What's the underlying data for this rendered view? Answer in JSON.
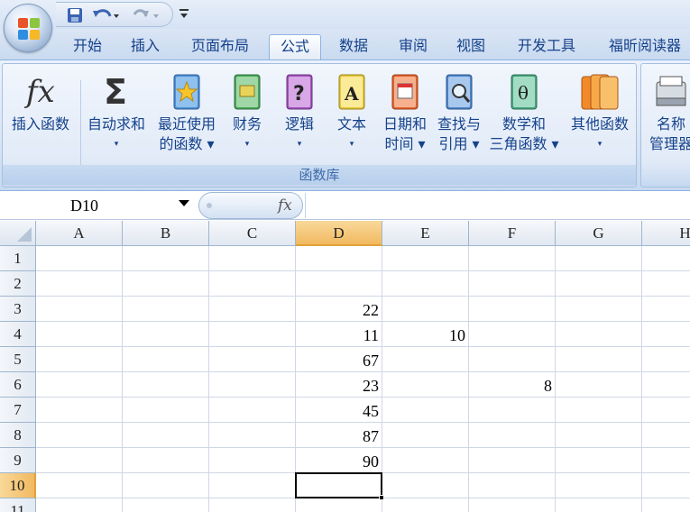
{
  "tabs": [
    {
      "label": "开始",
      "active": false
    },
    {
      "label": "插入",
      "active": false
    },
    {
      "label": "页面布局",
      "active": false
    },
    {
      "label": "公式",
      "active": true
    },
    {
      "label": "数据",
      "active": false
    },
    {
      "label": "审阅",
      "active": false
    },
    {
      "label": "视图",
      "active": false
    },
    {
      "label": "开发工具",
      "active": false
    },
    {
      "label": "福昕阅读器",
      "active": false
    }
  ],
  "ribbon": {
    "group_label": "函数库",
    "buttons": [
      {
        "line1": "插入函数",
        "line2": "",
        "icon": "fx-icon"
      },
      {
        "line1": "自动求和",
        "line2": "▾",
        "icon": "sigma-icon"
      },
      {
        "line1": "最近使用",
        "line2": "的函数 ▾",
        "icon": "star-book-icon"
      },
      {
        "line1": "财务",
        "line2": "▾",
        "icon": "money-book-icon"
      },
      {
        "line1": "逻辑",
        "line2": "▾",
        "icon": "question-book-icon"
      },
      {
        "line1": "文本",
        "line2": "▾",
        "icon": "text-book-icon"
      },
      {
        "line1": "日期和",
        "line2": "时间 ▾",
        "icon": "calendar-book-icon"
      },
      {
        "line1": "查找与",
        "line2": "引用 ▾",
        "icon": "magnifier-book-icon"
      },
      {
        "line1": "数学和",
        "line2": "三角函数 ▾",
        "icon": "theta-book-icon"
      },
      {
        "line1": "其他函数",
        "line2": "▾",
        "icon": "multi-book-icon"
      }
    ],
    "name_manager": {
      "line1": "名称",
      "line2": "管理器"
    }
  },
  "formula_bar": {
    "name_box": "D10",
    "fx_label": "fx",
    "formula": ""
  },
  "grid": {
    "columns": [
      "A",
      "B",
      "C",
      "D",
      "E",
      "F",
      "G",
      "H"
    ],
    "selected_column": "D",
    "rows": [
      "1",
      "2",
      "3",
      "4",
      "5",
      "6",
      "7",
      "8",
      "9",
      "10",
      "11"
    ],
    "selected_row": "10",
    "cells": [
      {
        "ref": "D3",
        "value": "22"
      },
      {
        "ref": "D4",
        "value": "11"
      },
      {
        "ref": "E4",
        "value": "10"
      },
      {
        "ref": "D5",
        "value": "67"
      },
      {
        "ref": "D6",
        "value": "23"
      },
      {
        "ref": "F6",
        "value": "8"
      },
      {
        "ref": "D7",
        "value": "45"
      },
      {
        "ref": "D8",
        "value": "87"
      },
      {
        "ref": "D9",
        "value": "90"
      }
    ],
    "active_cell": "D10"
  },
  "colors": {
    "accent": "#15428b",
    "selected_header": "#f1b960",
    "ribbon_bg": "#dce7f5"
  }
}
